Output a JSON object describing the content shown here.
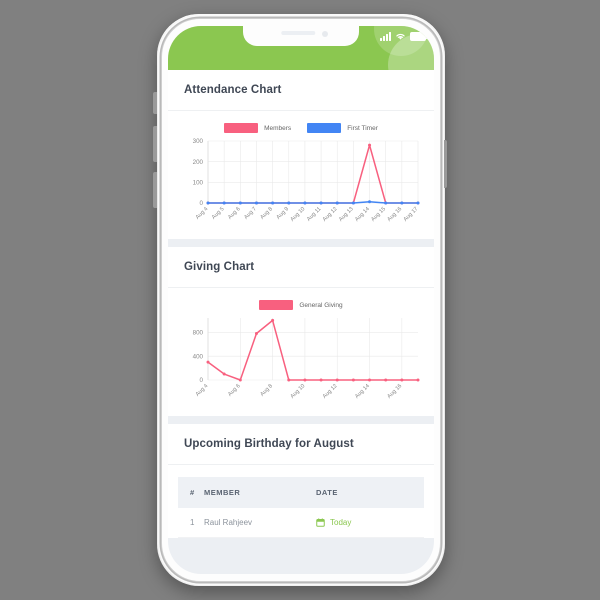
{
  "device": {
    "status_bar": {
      "signal_icon": "signal-bars-icon",
      "wifi_icon": "wifi-icon",
      "battery_icon": "battery-icon"
    },
    "header_color": "#8bc750"
  },
  "cards": [
    {
      "title": "Attendance Chart"
    },
    {
      "title": "Giving Chart"
    },
    {
      "title": "Upcoming Birthday for August"
    }
  ],
  "birthday_table": {
    "columns": [
      "#",
      "MEMBER",
      "DATE"
    ],
    "rows": [
      {
        "num": "1",
        "member": "Raul Rahjeev",
        "date": "Today",
        "date_icon": "calendar-icon"
      }
    ]
  },
  "colors": {
    "members": "#f8607f",
    "first_timer": "#4285f4",
    "general_giving": "#f8607f",
    "brand_green": "#8bc750",
    "page_bg": "#eceff3"
  },
  "chart_data": [
    {
      "type": "line",
      "title": "Attendance Chart",
      "xlabel": "",
      "ylabel": "",
      "categories": [
        "Aug 4",
        "Aug 5",
        "Aug 6",
        "Aug 7",
        "Aug 8",
        "Aug 9",
        "Aug 10",
        "Aug 11",
        "Aug 12",
        "Aug 13",
        "Aug 14",
        "Aug 15",
        "Aug 16",
        "Aug 17"
      ],
      "yticks": [
        0,
        100,
        200,
        300
      ],
      "ylim": [
        0,
        300
      ],
      "grid": true,
      "legend_position": "top-center",
      "series": [
        {
          "name": "Members",
          "color": "#f8607f",
          "values": [
            0,
            0,
            0,
            0,
            0,
            0,
            0,
            0,
            0,
            0,
            280,
            0,
            0,
            0
          ]
        },
        {
          "name": "First Timer",
          "color": "#4285f4",
          "values": [
            0,
            0,
            0,
            0,
            0,
            0,
            0,
            0,
            0,
            0,
            6,
            0,
            0,
            0
          ]
        }
      ]
    },
    {
      "type": "line",
      "title": "Giving Chart",
      "xlabel": "",
      "ylabel": "",
      "categories": [
        "Aug 4",
        "Aug 5",
        "Aug 6",
        "Aug 7",
        "Aug 8",
        "Aug 9",
        "Aug 10",
        "Aug 11",
        "Aug 12",
        "Aug 13",
        "Aug 14",
        "Aug 15",
        "Aug 16",
        "Aug 17"
      ],
      "xtick_labels": [
        "Aug 4",
        "",
        "Aug 6",
        "",
        "Aug 8",
        "",
        "Aug 10",
        "",
        "Aug 12",
        "",
        "Aug 14",
        "",
        "Aug 16",
        ""
      ],
      "yticks": [
        0,
        400,
        800
      ],
      "ylim": [
        0,
        1040
      ],
      "grid": true,
      "legend_position": "top-center",
      "series": [
        {
          "name": "General Giving",
          "color": "#f8607f",
          "values": [
            300,
            100,
            0,
            780,
            1000,
            0,
            0,
            0,
            0,
            0,
            0,
            0,
            0,
            0
          ]
        }
      ]
    }
  ]
}
